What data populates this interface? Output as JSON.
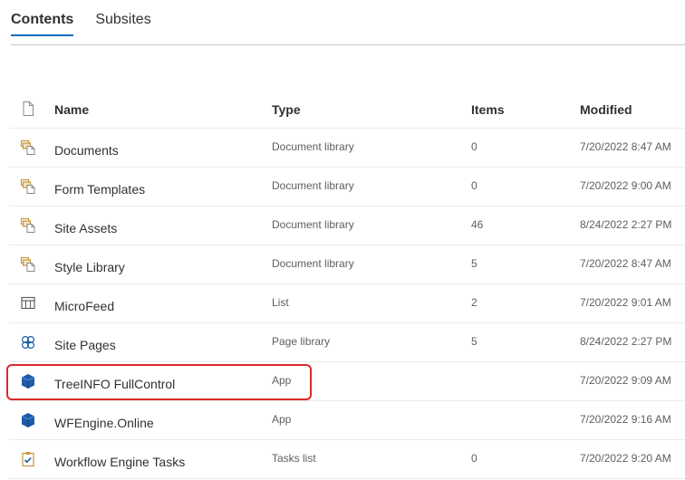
{
  "tabs": [
    {
      "label": "Contents",
      "active": true
    },
    {
      "label": "Subsites",
      "active": false
    }
  ],
  "table": {
    "headers": {
      "name": "Name",
      "type": "Type",
      "items": "Items",
      "modified": "Modified"
    },
    "rows": [
      {
        "icon": "document-library-icon",
        "name": "Documents",
        "type": "Document library",
        "items": "0",
        "modified": "7/20/2022 8:47 AM"
      },
      {
        "icon": "document-library-icon",
        "name": "Form Templates",
        "type": "Document library",
        "items": "0",
        "modified": "7/20/2022 9:00 AM"
      },
      {
        "icon": "document-library-icon",
        "name": "Site Assets",
        "type": "Document library",
        "items": "46",
        "modified": "8/24/2022 2:27 PM"
      },
      {
        "icon": "document-library-icon",
        "name": "Style Library",
        "type": "Document library",
        "items": "5",
        "modified": "7/20/2022 8:47 AM"
      },
      {
        "icon": "list-icon",
        "name": "MicroFeed",
        "type": "List",
        "items": "2",
        "modified": "7/20/2022 9:01 AM"
      },
      {
        "icon": "page-library-icon",
        "name": "Site Pages",
        "type": "Page library",
        "items": "5",
        "modified": "8/24/2022 2:27 PM"
      },
      {
        "icon": "app-icon",
        "name": "TreeINFO FullControl",
        "type": "App",
        "items": "",
        "modified": "7/20/2022 9:09 AM"
      },
      {
        "icon": "app-icon",
        "name": "WFEngine.Online",
        "type": "App",
        "items": "",
        "modified": "7/20/2022 9:16 AM"
      },
      {
        "icon": "tasks-list-icon",
        "name": "Workflow Engine Tasks",
        "type": "Tasks list",
        "items": "0",
        "modified": "7/20/2022 9:20 AM"
      }
    ]
  },
  "colors": {
    "accent": "#0f6cbd",
    "highlight": "#d92a2a",
    "library_icon": "#c8963e",
    "app_icon": "#1e5ba8"
  }
}
